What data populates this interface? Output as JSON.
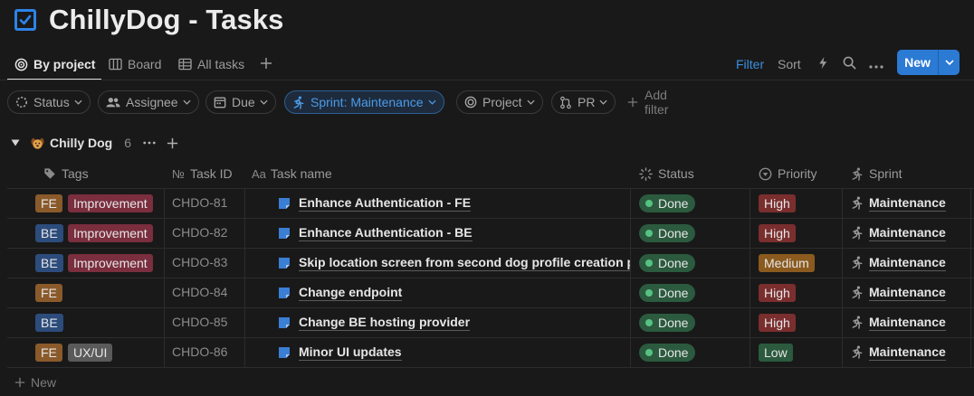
{
  "page": {
    "title": "ChillyDog - Tasks"
  },
  "views": {
    "tabs": [
      {
        "label": "By project",
        "icon": "target-icon",
        "active": true
      },
      {
        "label": "Board",
        "icon": "board-icon"
      },
      {
        "label": "All tasks",
        "icon": "table-icon"
      }
    ],
    "add_view_icon": "plus-icon"
  },
  "toolbar": {
    "filter_label": "Filter",
    "sort_label": "Sort",
    "automation_icon": "lightning-icon",
    "search_icon": "search-icon",
    "more_icon": "ellipsis-icon",
    "new_label": "New"
  },
  "filters": {
    "chips": [
      {
        "label": "Status",
        "icon": "status-icon"
      },
      {
        "label": "Assignee",
        "icon": "people-icon"
      },
      {
        "label": "Due",
        "icon": "calendar-icon"
      },
      {
        "label": "Sprint: Maintenance",
        "icon": "runner-icon",
        "active": true
      },
      {
        "label": "Project",
        "icon": "target-icon"
      },
      {
        "label": "PR",
        "icon": "pull-request-icon"
      }
    ],
    "add_filter_label": "Add filter"
  },
  "group": {
    "name": "Chilly Dog",
    "count": "6",
    "emoji_icon": "dog-face-icon"
  },
  "columns": {
    "tags": "Tags",
    "task_id": "Task ID",
    "task_name": "Task name",
    "status": "Status",
    "priority": "Priority",
    "sprint": "Sprint"
  },
  "rows": [
    {
      "tags": [
        "FE",
        "Improvement"
      ],
      "task_id": "CHDO-81",
      "name": "Enhance Authentication - FE",
      "status": "Done",
      "priority": "High",
      "sprint": "Maintenance"
    },
    {
      "tags": [
        "BE",
        "Improvement"
      ],
      "task_id": "CHDO-82",
      "name": "Enhance Authentication - BE",
      "status": "Done",
      "priority": "High",
      "sprint": "Maintenance"
    },
    {
      "tags": [
        "BE",
        "Improvement"
      ],
      "task_id": "CHDO-83",
      "name": "Skip location screen from second dog profile creation pr",
      "status": "Done",
      "priority": "Medium",
      "sprint": "Maintenance"
    },
    {
      "tags": [
        "FE"
      ],
      "task_id": "CHDO-84",
      "name": "Change endpoint",
      "status": "Done",
      "priority": "High",
      "sprint": "Maintenance"
    },
    {
      "tags": [
        "BE"
      ],
      "task_id": "CHDO-85",
      "name": "Change BE hosting provider",
      "status": "Done",
      "priority": "High",
      "sprint": "Maintenance"
    },
    {
      "tags": [
        "FE",
        "UX/UI"
      ],
      "task_id": "CHDO-86",
      "name": "Minor UI updates",
      "status": "Done",
      "priority": "Low",
      "sprint": "Maintenance"
    }
  ],
  "footer": {
    "new_label": "New"
  },
  "colors": {
    "background": "#191919",
    "accent": "#2b7ad4",
    "tag_fe": "#8a5a2b",
    "tag_be": "#2c4c7c",
    "tag_improvement": "#7a2e3e",
    "tag_uxui": "#5a5a5a",
    "status_done": "#2b5a3e",
    "priority_high": "#7a2e2e",
    "priority_medium": "#8a5a1e",
    "priority_low": "#2b5a3e"
  }
}
